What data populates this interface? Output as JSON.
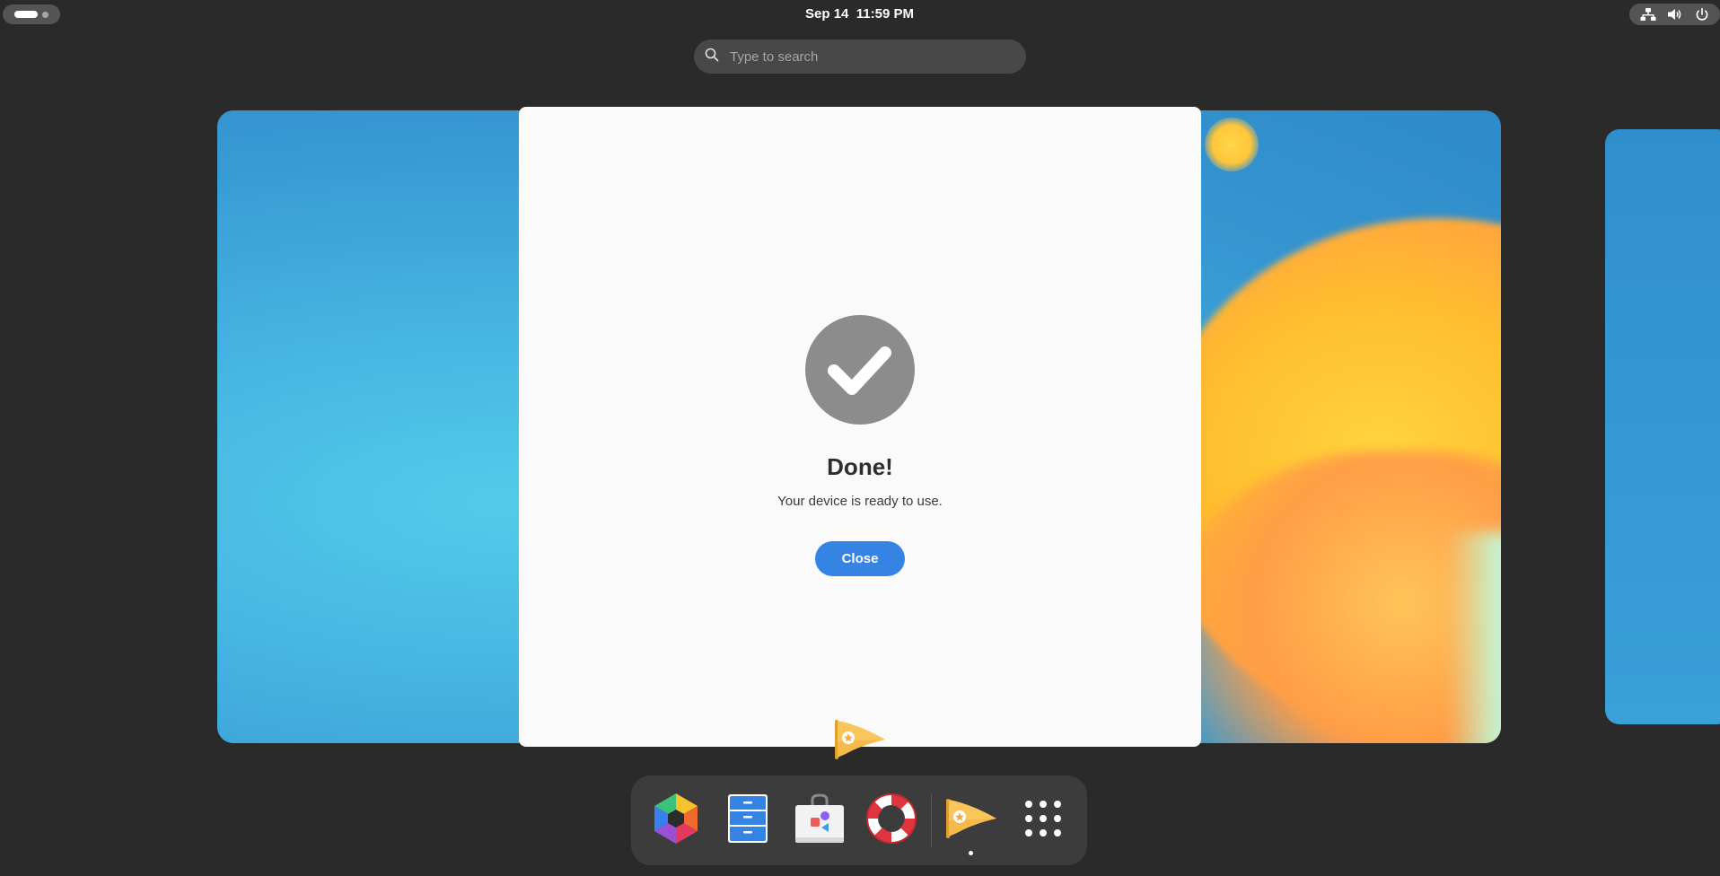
{
  "topbar": {
    "clock_date": "Sep 14",
    "clock_time": "11:59 PM",
    "status_icons": [
      "network-wired-icon",
      "volume-icon",
      "power-icon"
    ]
  },
  "search": {
    "placeholder": "Type to search"
  },
  "dialog": {
    "title": "Done!",
    "subtitle": "Your device is ready to use.",
    "close_label": "Close",
    "icon": "checkmark-circle-icon"
  },
  "dock": {
    "apps": [
      {
        "name": "GNOME Color App",
        "icon": "hexagon-palette-icon"
      },
      {
        "name": "Files",
        "icon": "file-cabinet-icon"
      },
      {
        "name": "Software",
        "icon": "store-bag-icon"
      },
      {
        "name": "Help",
        "icon": "lifebuoy-icon"
      },
      {
        "name": "Initial Setup",
        "icon": "pennant-flag-icon",
        "running": true
      },
      {
        "name": "Show Applications",
        "icon": "app-grid-icon"
      }
    ]
  },
  "colors": {
    "accent": "#3584e4",
    "background": "#2a2a2a",
    "dialog_bg": "#fafafa",
    "check_circle": "#8c8c8c"
  }
}
